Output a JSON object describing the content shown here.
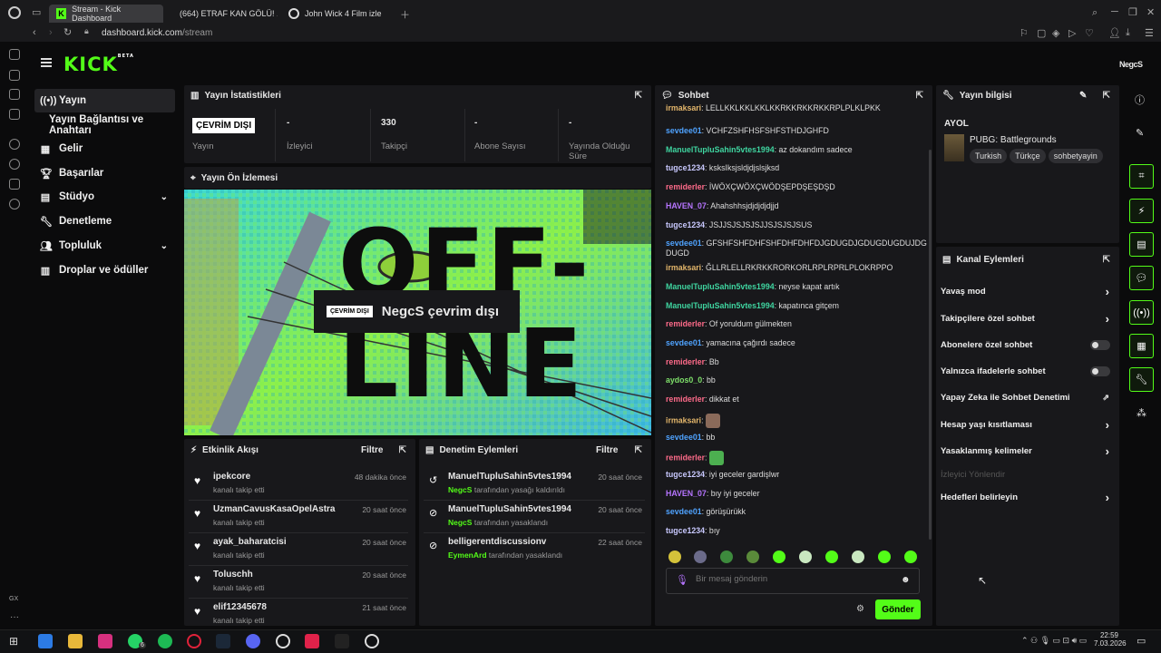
{
  "browser": {
    "tabs": [
      {
        "title": "Stream - Kick Dashboard"
      },
      {
        "title": "(664) ETRAF KAN GÖLÜ! ..."
      },
      {
        "title": "John Wick 4 Film izle"
      }
    ],
    "url_domain": "dashboard.kick.com",
    "url_path": "/stream"
  },
  "app": {
    "logo": "KICK",
    "logo_beta": "BETA",
    "user": "NegcS",
    "nav": [
      {
        "label": "Yayın",
        "icon": "broadcast-icon"
      },
      {
        "label": "Yayın Bağlantısı ve Anahtarı",
        "icon": ""
      },
      {
        "label": "Gelir",
        "icon": "chart-icon"
      },
      {
        "label": "Başarılar",
        "icon": "trophy-icon"
      },
      {
        "label": "Stüdyo",
        "icon": "studio-icon"
      },
      {
        "label": "Denetleme",
        "icon": "wrench-icon"
      },
      {
        "label": "Topluluk",
        "icon": "community-icon"
      },
      {
        "label": "Droplar ve ödüller",
        "icon": "gift-icon"
      }
    ]
  },
  "stats": {
    "title": "Yayın İstatistikleri",
    "items": [
      {
        "value": "ÇEVRİM DIŞI",
        "label": "Yayın"
      },
      {
        "value": "-",
        "label": "İzleyici"
      },
      {
        "value": "330",
        "label": "Takipçi"
      },
      {
        "value": "-",
        "label": "Abone Sayısı"
      },
      {
        "value": "-",
        "label": "Yayında Olduğu Süre"
      }
    ]
  },
  "preview": {
    "title": "Yayın Ön İzlemesi",
    "badge": "ÇEVRİM DIŞI",
    "message": "NegcS çevrim dışı",
    "art_top": "OFF-",
    "art_bottom": "LINE"
  },
  "activity": {
    "title": "Etkinlik Akışı",
    "filter": "Filtre",
    "items": [
      {
        "name": "ipekcore",
        "sub": "kanalı takip etti",
        "time": "48 dakika önce"
      },
      {
        "name": "UzmanCavusKasaOpelAstra",
        "sub": "kanalı takip etti",
        "time": "20 saat önce"
      },
      {
        "name": "ayak_baharatcisi",
        "sub": "kanalı takip etti",
        "time": "20 saat önce"
      },
      {
        "name": "Toluschh",
        "sub": "kanalı takip etti",
        "time": "20 saat önce"
      },
      {
        "name": "elif12345678",
        "sub": "kanalı takip etti",
        "time": "21 saat önce"
      }
    ]
  },
  "moderation": {
    "title": "Denetim Eylemleri",
    "filter": "Filtre",
    "items": [
      {
        "name": "ManuelTupluSahin5vtes1994",
        "actor": "NegcS",
        "sub": " tarafından yasağı kaldırıldı",
        "time": "20 saat önce"
      },
      {
        "name": "ManuelTupluSahin5vtes1994",
        "actor": "NegcS",
        "sub": " tarafından yasaklandı",
        "time": "20 saat önce"
      },
      {
        "name": "belligerentdiscussionv",
        "actor": "EymenArd",
        "sub": " tarafından yasaklandı",
        "time": "22 saat önce"
      }
    ]
  },
  "chat": {
    "title": "Sohbet",
    "messages": [
      {
        "user": "irmaksari",
        "color": "#e3b66b",
        "text": "LELLKKLKKLKKLKKRKKRKKRKKRPLPLKLPKK"
      },
      {
        "user": "sevdee01",
        "color": "#4fa3ff",
        "text": "VCHFZSHFHSFSHFSTHDJGHFD"
      },
      {
        "user": "ManuelTupluSahin5vtes1994",
        "color": "#3fd5a0",
        "text": "az dokandım sadece"
      },
      {
        "user": "tugce1234",
        "color": "#c9c9ff",
        "text": "ksksIksjsldjdjslsjksd"
      },
      {
        "user": "remiderler",
        "color": "#ff6b8a",
        "text": "İWÖXÇWÖXÇWÖDŞEPDŞEŞDŞD"
      },
      {
        "user": "HAVEN_07",
        "color": "#b675ff",
        "text": "Ahahshhsjdjdjdjdjjd"
      },
      {
        "user": "tugce1234",
        "color": "#c9c9ff",
        "text": "JSJJSJSJSJSJJSJSJSJSUS"
      },
      {
        "user": "sevdee01",
        "color": "#4fa3ff",
        "text": "GFSHFSHFDHFSHFDHFDHFDJGDUGDJGDUGDUGDUJDGDUGD"
      },
      {
        "user": "irmaksari",
        "color": "#e3b66b",
        "text": "ĞLLRLELLRKRKKRORKORLRPLRPRLPLOKRPPO"
      },
      {
        "user": "ManuelTupluSahin5vtes1994",
        "color": "#3fd5a0",
        "text": "neyse kapat artık"
      },
      {
        "user": "ManuelTupluSahin5vtes1994",
        "color": "#3fd5a0",
        "text": "kapatınca gitçem"
      },
      {
        "user": "remiderler",
        "color": "#ff6b8a",
        "text": "Of yoruldum gülmekten"
      },
      {
        "user": "sevdee01",
        "color": "#4fa3ff",
        "text": "yamacına çağırdı sadece"
      },
      {
        "user": "remiderler",
        "color": "#ff6b8a",
        "text": "Bb"
      },
      {
        "user": "aydos0_0",
        "color": "#7ee06a",
        "text": "bb"
      },
      {
        "user": "remiderler",
        "color": "#ff6b8a",
        "text": "dikkat et"
      },
      {
        "user": "irmaksari",
        "color": "#e3b66b",
        "text": ""
      },
      {
        "user": "sevdee01",
        "color": "#4fa3ff",
        "text": "bb"
      },
      {
        "user": "remiderler",
        "color": "#ff6b8a",
        "text": ""
      },
      {
        "user": "tugce1234",
        "color": "#c9c9ff",
        "text": "iyi geceler gardişlwr"
      },
      {
        "user": "HAVEN_07",
        "color": "#b675ff",
        "text": "bıy iyi geceler"
      },
      {
        "user": "sevdee01",
        "color": "#4fa3ff",
        "text": "görüşürükk"
      },
      {
        "user": "tugce1234",
        "color": "#c9c9ff",
        "text": "bıy"
      }
    ],
    "placeholder": "Bir mesaj gönderin",
    "send": "Gönder"
  },
  "info": {
    "title": "Yayın bilgisi",
    "stream_title": "AYOL",
    "category": "PUBG: Battlegrounds",
    "tags": [
      "Turkish",
      "Türkçe",
      "sohbetyayin"
    ]
  },
  "channel_actions": {
    "title": "Kanal Eylemleri",
    "items": [
      {
        "label": "Yavaş mod",
        "control": "arrow"
      },
      {
        "label": "Takipçilere özel sohbet",
        "control": "arrow"
      },
      {
        "label": "Abonelere özel sohbet",
        "control": "toggle"
      },
      {
        "label": "Yalnızca ifadelerle sohbet",
        "control": "toggle"
      },
      {
        "label": "Yapay Zeka ile Sohbet Denetimi",
        "control": "external"
      },
      {
        "label": "Hesap yaşı kısıtlaması",
        "control": "arrow"
      },
      {
        "label": "Yasaklanmış kelimeler",
        "control": "arrow"
      },
      {
        "label": "İzleyici Yönlendir",
        "control": "disabled"
      },
      {
        "label": "Hedefleri belirleyin",
        "control": "arrow"
      }
    ]
  },
  "taskbar": {
    "time": "22:59",
    "date": "7.03.2026",
    "whatsapp_badge": "6"
  },
  "colors": {
    "accent": "#53fc18",
    "panel": "#18181b",
    "bg": "#0b0b0c"
  }
}
